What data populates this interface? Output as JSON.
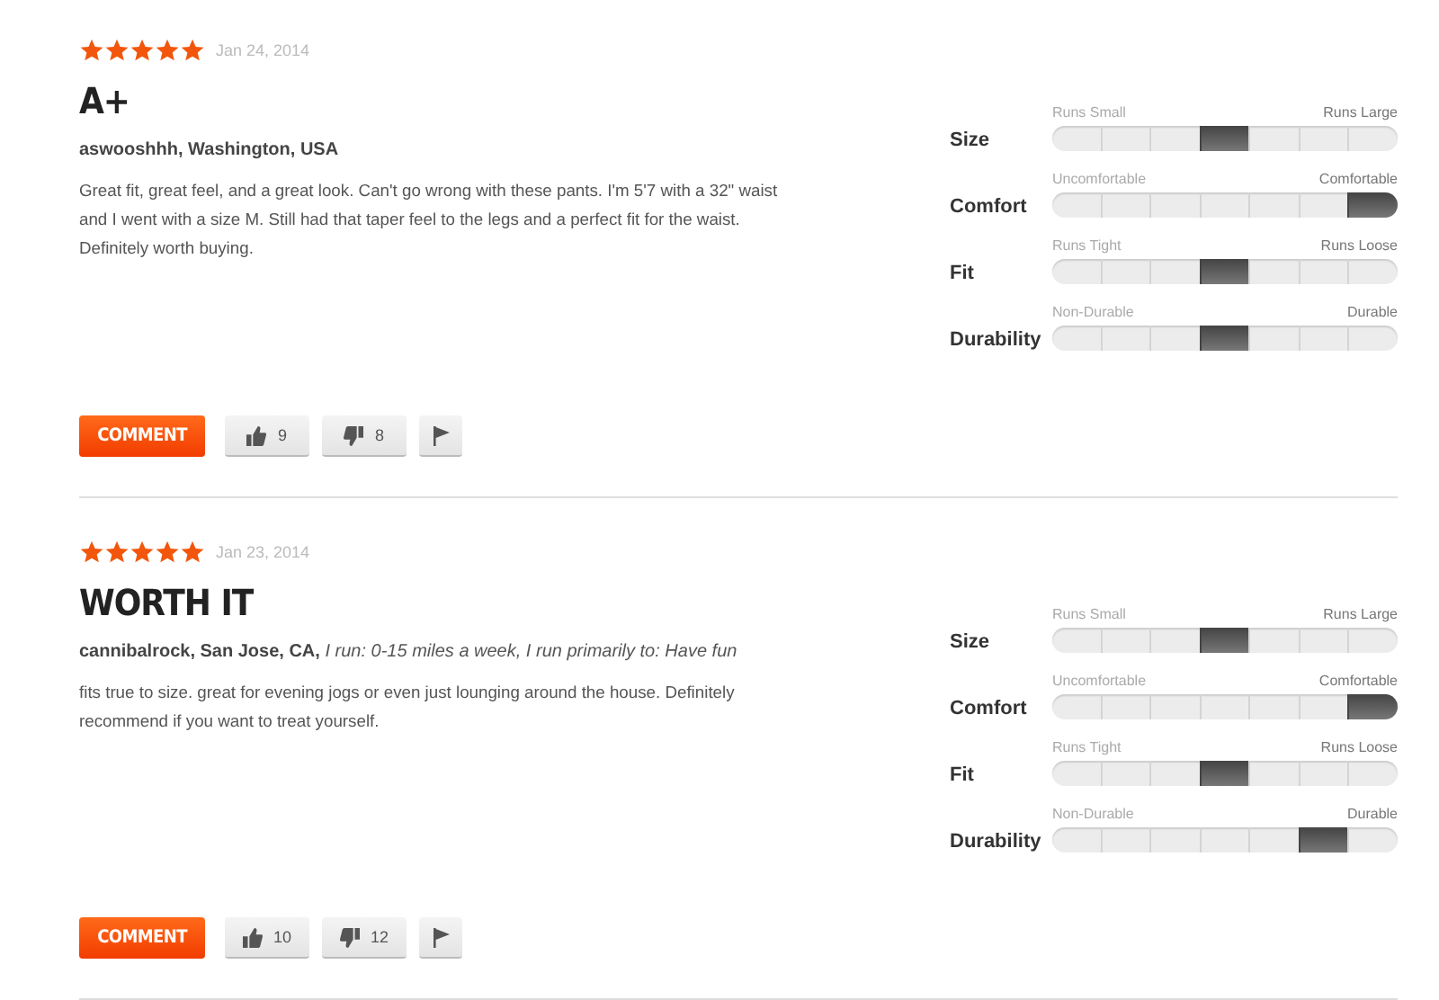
{
  "reviews": [
    {
      "stars": 5,
      "date": "Jan 24, 2014",
      "title": "A+",
      "author": "aswooshhh, Washington, USA",
      "body": "Great fit, great feel, and a great look. Can't go wrong with these pants. I'm 5'7 with a 32\" waist and I went with a size M. Still had that taper feel to the legs and a perfect fit for the waist. Definitely worth buying.",
      "ratings": [
        {
          "label": "Size",
          "low": "Runs Small",
          "high": "Runs Large",
          "level": 0.5
        },
        {
          "label": "Comfort",
          "low": "Uncomfortable",
          "high": "Comfortable",
          "level": 1
        },
        {
          "label": "Fit",
          "low": "Runs Tight",
          "high": "Runs Loose",
          "level": 0.5
        },
        {
          "label": "Durability",
          "low": "Non-Durable",
          "high": "Durable",
          "level": 0.5
        }
      ],
      "comment_button": "COMMENT",
      "helpful_count": "9",
      "unhelpful_count": "8"
    },
    {
      "stars": 5,
      "date": "Jan 23, 2014",
      "title": "WORTH IT",
      "author": "cannibalrock, San Jose, CA,",
      "runner_info": "I run: 0-15 miles a week, I run primarily to: Have fun",
      "body": "fits true to size. great for evening jogs or even just lounging around the house. Definitely recommend if you want to treat yourself.",
      "ratings": [
        {
          "label": "Size",
          "low": "Runs Small",
          "high": "Runs Large",
          "level": 0.5
        },
        {
          "label": "Comfort",
          "low": "Uncomfortable",
          "high": "Comfortable",
          "level": 1
        },
        {
          "label": "Fit",
          "low": "Runs Tight",
          "high": "Runs Loose",
          "level": 0.5
        },
        {
          "label": "Durability",
          "low": "Non-Durable",
          "high": "Durable",
          "level": 0.8333
        }
      ],
      "comment_button": "COMMENT",
      "helpful_count": "10",
      "unhelpful_count": "12"
    }
  ]
}
